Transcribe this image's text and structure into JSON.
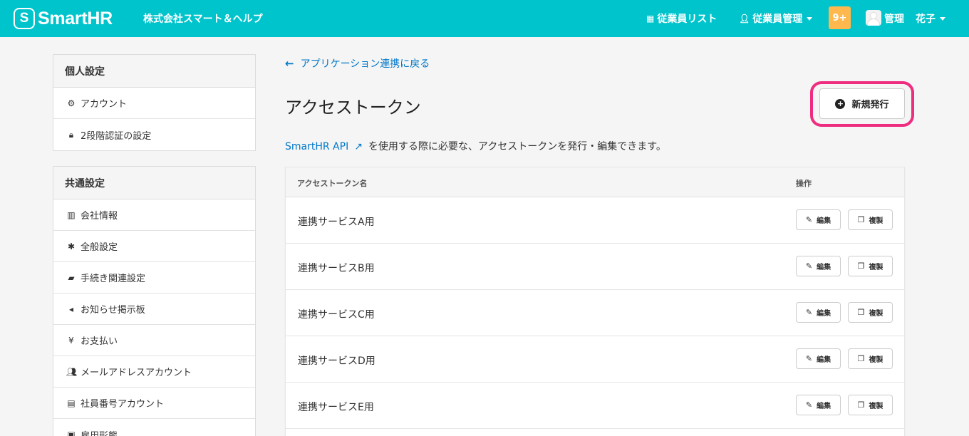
{
  "header": {
    "logo_mark": "S",
    "logo_text": "SmartHR",
    "company": "株式会社スマート＆ヘルプ",
    "nav_list": "従業員リスト",
    "nav_manage": "従業員管理",
    "badge": "9+",
    "user_role": "管理",
    "user_name": "花子"
  },
  "sidebar": {
    "personal_title": "個人設定",
    "personal_items": [
      {
        "label": "アカウント",
        "icon": "gear-icon"
      },
      {
        "label": "2段階認証の設定",
        "icon": "lock-icon"
      }
    ],
    "common_title": "共通設定",
    "common_items": [
      {
        "label": "会社情報",
        "icon": "building-icon"
      },
      {
        "label": "全般設定",
        "icon": "asterisk-icon"
      },
      {
        "label": "手続き関連設定",
        "icon": "book-icon"
      },
      {
        "label": "お知らせ掲示板",
        "icon": "megaphone-icon"
      },
      {
        "label": "お支払い",
        "icon": "yen-icon"
      },
      {
        "label": "メールアドレスアカウント",
        "icon": "users-icon"
      },
      {
        "label": "社員番号アカウント",
        "icon": "id-card-icon"
      },
      {
        "label": "雇用形態",
        "icon": "badge-icon"
      }
    ]
  },
  "main": {
    "back_link": "アプリケーション連携に戻る",
    "title": "アクセストークン",
    "new_button": "新規発行",
    "desc_link": "SmartHR API",
    "desc_text": "を使用する際に必要な、アクセストークンを発行・編集できます。",
    "table": {
      "col_name": "アクセストークン名",
      "col_ops": "操作",
      "edit_label": "編集",
      "copy_label": "複製",
      "rows": [
        "連携サービスA用",
        "連携サービスB用",
        "連携サービスC用",
        "連携サービスD用",
        "連携サービスE用"
      ]
    }
  },
  "colors": {
    "header_bg": "#00c4cc",
    "badge_bg": "#ffb84d",
    "link": "#0077c7",
    "highlight": "#ee2d81"
  }
}
